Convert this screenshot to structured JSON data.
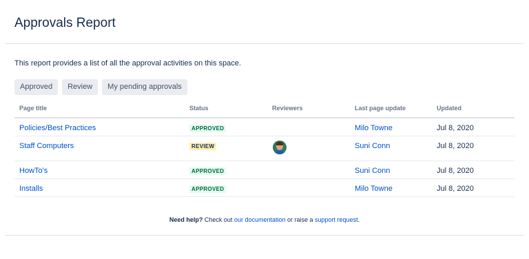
{
  "page": {
    "title": "Approvals Report",
    "intro": "This report provides a list of all the approval activities on this space."
  },
  "tabs": [
    {
      "label": "Approved"
    },
    {
      "label": "Review"
    },
    {
      "label": "My pending approvals"
    }
  ],
  "table": {
    "headers": [
      "Page title",
      "Status",
      "Reviewers",
      "Last page update",
      "Updated"
    ],
    "rows": [
      {
        "page_title": "Policies/Best Practices",
        "status": "APPROVED",
        "reviewer": "",
        "last_update_by": "Milo Towne",
        "updated": "Jul 8, 2020"
      },
      {
        "page_title": "Staff Computers",
        "status": "REVIEW",
        "reviewer": "avatar",
        "last_update_by": "Suni Conn",
        "updated": "Jul 8, 2020"
      },
      {
        "page_title": "HowTo's",
        "status": "APPROVED",
        "reviewer": "",
        "last_update_by": "Suni Conn",
        "updated": "Jul 8, 2020"
      },
      {
        "page_title": "Installs",
        "status": "APPROVED",
        "reviewer": "",
        "last_update_by": "Milo Towne",
        "updated": "Jul 8, 2020"
      }
    ]
  },
  "help": {
    "lead": "Need help?",
    "text1": " Check out ",
    "documentation_link": "our documentation",
    "text2": " or raise a ",
    "support_link": "support request",
    "text3": "."
  },
  "colors": {
    "link": "#0052cc",
    "approved_bg": "#e3fcef",
    "approved_fg": "#006644",
    "review_bg": "#fff0b3"
  }
}
